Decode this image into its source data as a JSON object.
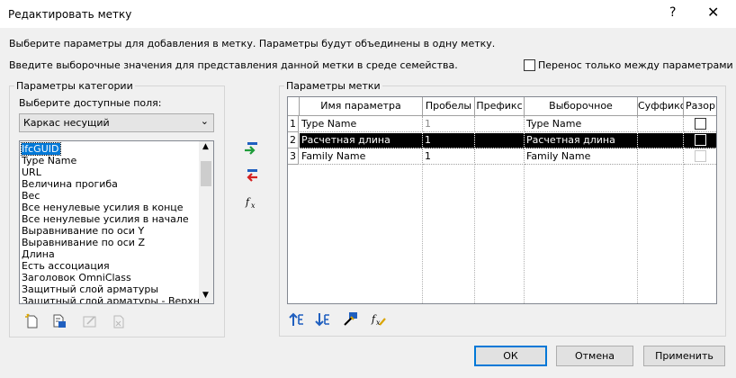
{
  "window": {
    "title": "Редактировать метку",
    "help": "?",
    "close": "✕"
  },
  "instructions": {
    "line1": "Выберите параметры для добавления в метку.  Параметры будут объединены в одну метку.",
    "line2": "Введите выборочные значения для представления данной метки в среде семейства."
  },
  "wrap_checkbox": {
    "label": "Перенос только между параметрами",
    "checked": false
  },
  "category_group": {
    "title": "Параметры категории",
    "fields_label": "Выберите доступные поля:",
    "combo_value": "Каркас несущий",
    "fields": [
      "IfcGUID",
      "Type Name",
      "URL",
      "Величина прогиба",
      "Вес",
      "Все ненулевые усилия в конце",
      "Все ненулевые усилия в начале",
      "Выравнивание по оси Y",
      "Выравнивание по оси Z",
      "Длина",
      "Есть ассоциация",
      "Заголовок OmniClass",
      "Защитный слой арматуры",
      "Защитный слой арматуры - Верхняя гр"
    ],
    "selected_index": 0
  },
  "label_group": {
    "title": "Параметры метки",
    "columns": [
      "Имя параметра",
      "Пробелы",
      "Префикс",
      "Выборочное",
      "Суффикс",
      "Разор"
    ],
    "rows": [
      {
        "num": "1",
        "name": "Type Name",
        "spaces": "1",
        "prefix": "",
        "sample": "Type Name",
        "suffix": "",
        "break": false
      },
      {
        "num": "2",
        "name": "Расчетная длина",
        "spaces": "1",
        "prefix": "",
        "sample": "Расчетная длина",
        "suffix": "",
        "break": false
      },
      {
        "num": "3",
        "name": "Family Name",
        "spaces": "1",
        "prefix": "",
        "sample": "Family Name",
        "suffix": "",
        "break": false
      }
    ],
    "selected_row": 1
  },
  "buttons": {
    "ok": "ОК",
    "cancel": "Отмена",
    "apply": "Применить"
  },
  "colors": {
    "selection": "#0078d7",
    "selected_row": "#000000",
    "add_arrow": "#1e9c3a",
    "remove_arrow": "#d42020",
    "icon_blue": "#1f5fbf"
  }
}
